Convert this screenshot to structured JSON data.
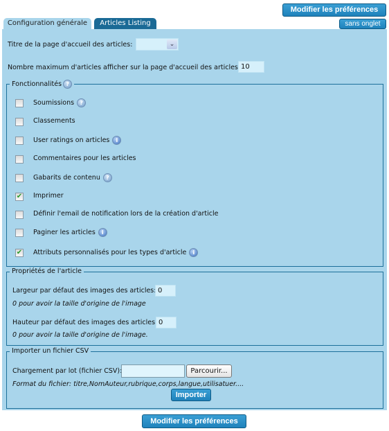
{
  "buttons": {
    "save_top": "Modifier les préférences",
    "no_tab": "sans onglet",
    "save_bottom": "Modifier les préférences",
    "import": "Importer",
    "browse": "Parcourir..."
  },
  "tabs": [
    {
      "label": "Configuration générale",
      "active": true
    },
    {
      "label": "Articles Listing",
      "active": false
    }
  ],
  "general": {
    "home_title_label": "Titre de la page d'accueil des articles:",
    "home_title_value": "",
    "max_articles_label": "Nombre maximum d'articles afficher sur la page d'accueil des articles:",
    "max_articles_value": "10"
  },
  "features": {
    "legend": "Fonctionnalités",
    "items": [
      {
        "label": "Soumissions",
        "checked": false,
        "icon": "help"
      },
      {
        "label": "Classements",
        "checked": false,
        "icon": ""
      },
      {
        "label": "User ratings on articles",
        "checked": false,
        "icon": "info"
      },
      {
        "label": "Commentaires pour les articles",
        "checked": false,
        "icon": ""
      },
      {
        "label": "Gabarits de contenu",
        "checked": false,
        "icon": "help"
      },
      {
        "label": "Imprimer",
        "checked": true,
        "icon": ""
      },
      {
        "label": "Définir l'email de notification lors de la création d'article",
        "checked": false,
        "icon": ""
      },
      {
        "label": "Paginer les articles",
        "checked": false,
        "icon": "info"
      },
      {
        "label": "Attributs personnalisés pour les types d'article",
        "checked": true,
        "icon": "info"
      }
    ]
  },
  "properties": {
    "legend": "Propriétés de l'article",
    "width_label": "Largeur par défaut des images des articles:",
    "width_value": "0",
    "width_note": "0 pour avoir la taille d'origine de l'image",
    "height_label": "Hauteur par défaut des images des articles:",
    "height_value": "0",
    "height_note": "0 pour avoir la taille d'origine de l'image."
  },
  "csv": {
    "legend": "Importer un fichier CSV",
    "upload_label": "Chargement par lot (fichier CSV):",
    "file_value": "",
    "format_note": "Format du fichier: titre,NomAuteur,rubrique,corps,langue,utilisatuer...."
  }
}
